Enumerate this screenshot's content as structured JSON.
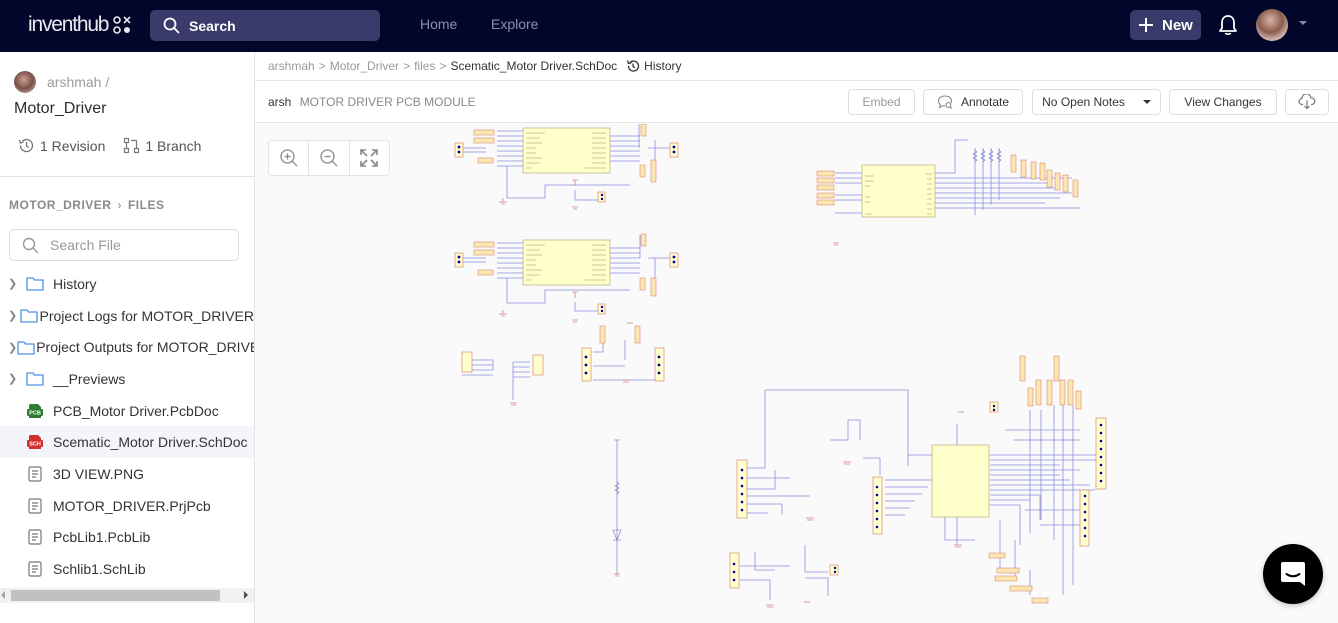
{
  "topbar": {
    "logo_text": "inventhub",
    "search_placeholder": "Search",
    "nav": [
      {
        "label": "Home"
      },
      {
        "label": "Explore"
      }
    ],
    "new_button_label": "New"
  },
  "sidebar": {
    "owner": "arshmah /",
    "project_name": "Motor_Driver",
    "revisions": "1 Revision",
    "branches": "1 Branch",
    "files_crumb": {
      "project": "MOTOR_DRIVER",
      "section": "FILES"
    },
    "file_search_placeholder": "Search File",
    "tree": [
      {
        "label": "History",
        "type": "folder"
      },
      {
        "label": "Project Logs for MOTOR_DRIVER",
        "type": "folder"
      },
      {
        "label": "Project Outputs for MOTOR_DRIVER",
        "type": "folder"
      },
      {
        "label": "__Previews",
        "type": "folder"
      },
      {
        "label": "PCB_Motor Driver.PcbDoc",
        "type": "pcb",
        "badge": "PCB"
      },
      {
        "label": "Scematic_Motor Driver.SchDoc",
        "type": "sch",
        "badge": "SCH",
        "selected": true
      },
      {
        "label": "3D VIEW.PNG",
        "type": "file"
      },
      {
        "label": "MOTOR_DRIVER.PrjPcb",
        "type": "file"
      },
      {
        "label": "PcbLib1.PcbLib",
        "type": "file"
      },
      {
        "label": "Schlib1.SchLib",
        "type": "file"
      }
    ]
  },
  "breadcrumb": {
    "items": [
      "arshmah",
      "Motor_Driver",
      "files"
    ],
    "current": "Scematic_Motor Driver.SchDoc",
    "separator": ">",
    "history_label": "History"
  },
  "document": {
    "author": "arsh",
    "title": "MOTOR DRIVER PCB MODULE"
  },
  "toolbar": {
    "embed": "Embed",
    "annotate": "Annotate",
    "notes_select": "No Open Notes",
    "view_changes": "View Changes"
  },
  "canvas": {
    "zoom_controls": [
      "zoom-in",
      "zoom-out",
      "fit-screen"
    ]
  },
  "colors": {
    "topbar_bg": "#03062b",
    "search_bg": "#3a3a6b",
    "wire": "#8080d0",
    "component_fill": "#ffffcc",
    "net_label_fill": "#fde7b0",
    "net_label_stroke": "#d9887a",
    "pin_dot": "#0000a0",
    "pcb_icon": "#2e7d32",
    "sch_icon": "#d32f2f",
    "folder_icon": "#4a90e2"
  }
}
